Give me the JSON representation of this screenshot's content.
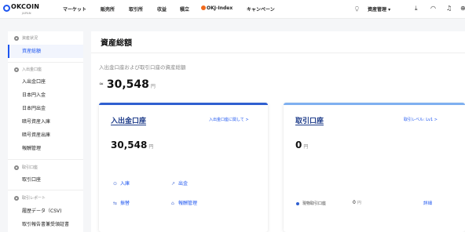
{
  "brand": {
    "name": "OKCOIN",
    "sub": "JAPAN"
  },
  "nav": [
    {
      "key": "market",
      "label": "マーケット"
    },
    {
      "key": "sales",
      "label": "販売所"
    },
    {
      "key": "exchange",
      "label": "取引所"
    },
    {
      "key": "earn",
      "label": "収益"
    },
    {
      "key": "savings",
      "label": "積立"
    },
    {
      "key": "okj",
      "label": "OKJ-Index"
    },
    {
      "key": "campaign",
      "label": "キャンペーン"
    }
  ],
  "header_right": {
    "account_label": "資産管理 ▾"
  },
  "sidebar": {
    "sections": [
      {
        "title": "資産状況",
        "items": [
          "資産総額"
        ]
      },
      {
        "title": "入出金口座",
        "items": [
          "入出金口座",
          "日本円入金",
          "日本円出金",
          "暗号資産入庫",
          "暗号資産出庫",
          "報酬管理"
        ]
      },
      {
        "title": "取引口座",
        "items": [
          "取引口座"
        ]
      },
      {
        "title": "取引レポート",
        "items": [
          "履歴データ（CSV)",
          "取引報告書兼受領証書"
        ]
      }
    ],
    "active_item": "資産総額"
  },
  "main": {
    "title": "資産総額",
    "total_label": "入出金口座および取引口座の資産総額",
    "total_prefix": "≈",
    "total_value": "30,548",
    "unit": "円"
  },
  "cards": {
    "deposit": {
      "title": "入出金口座",
      "link": "入出金口座に関して >",
      "value": "30,548",
      "unit": "円",
      "actions": {
        "deposit": "入庫",
        "withdraw": "出金",
        "transfer": "振替",
        "rewards": "報酬管理"
      }
    },
    "trading": {
      "title": "取引口座",
      "link": "取引レベル: Lv1 >",
      "value": "0",
      "unit": "円",
      "balance_row": {
        "label": "現物取引口座",
        "value": "0",
        "unit": "円",
        "link": "詳細"
      }
    }
  },
  "colors": {
    "accent": "#1e56f0",
    "card_deposit_bar": "#2f5fd0",
    "card_trading_bar": "#7fb0f0",
    "okj_dot": "#f06a1d"
  }
}
